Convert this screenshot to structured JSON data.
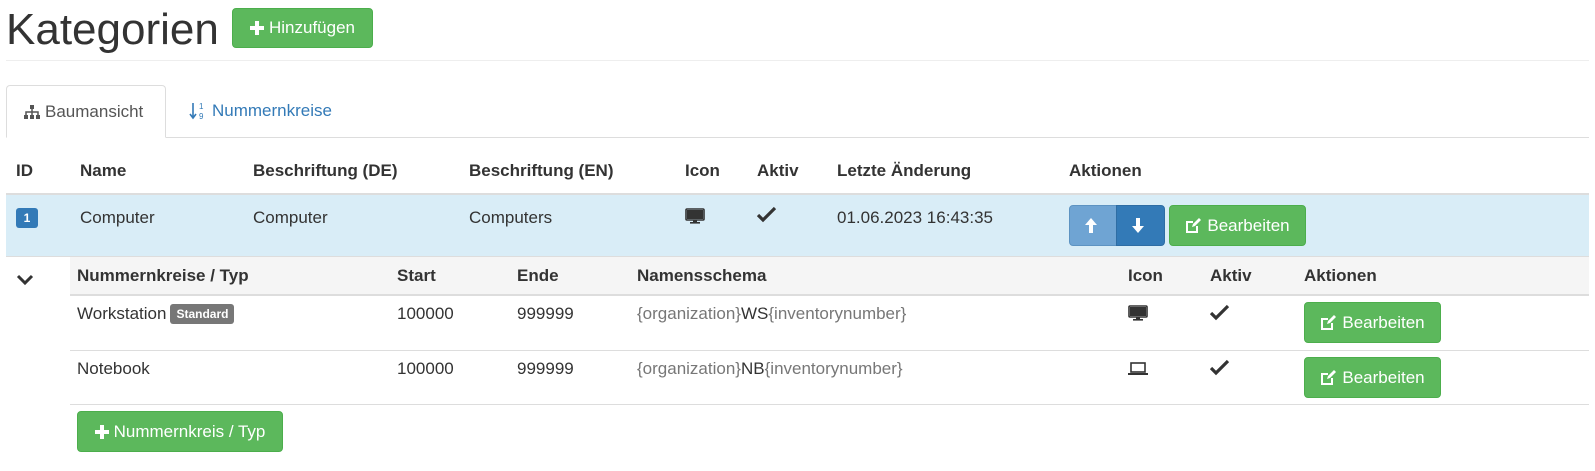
{
  "header": {
    "title": "Kategorien",
    "add_label": "Hinzufügen"
  },
  "tabs": [
    {
      "label": "Baumansicht",
      "icon": "sitemap-icon",
      "active": true
    },
    {
      "label": "Nummernkreise",
      "icon": "sort-numeric-icon",
      "active": false
    }
  ],
  "table": {
    "columns": [
      "ID",
      "Name",
      "Beschriftung (DE)",
      "Beschriftung (EN)",
      "Icon",
      "Aktiv",
      "Letzte Änderung",
      "Aktionen"
    ],
    "row": {
      "id": "1",
      "name": "Computer",
      "label_de": "Computer",
      "label_en": "Computers",
      "icon": "desktop-icon",
      "active": true,
      "last_change": "01.06.2023 16:43:35",
      "edit_label": "Bearbeiten"
    }
  },
  "subtable": {
    "columns": [
      "Nummernkreise / Typ",
      "Start",
      "Ende",
      "Namensschema",
      "Icon",
      "Aktiv",
      "Aktionen"
    ],
    "rows": [
      {
        "type": "Workstation",
        "badge": "Standard",
        "start": "100000",
        "end": "999999",
        "schema_pre": "{organization}",
        "schema_mid": "WS",
        "schema_post": "{inventorynumber}",
        "icon": "desktop-icon",
        "active": true,
        "edit_label": "Bearbeiten"
      },
      {
        "type": "Notebook",
        "badge": "",
        "start": "100000",
        "end": "999999",
        "schema_pre": "{organization}",
        "schema_mid": "NB",
        "schema_post": "{inventorynumber}",
        "icon": "laptop-icon",
        "active": true,
        "edit_label": "Bearbeiten"
      }
    ],
    "add_label": "Nummernkreis / Typ"
  },
  "colors": {
    "success": "#5cb85c",
    "primary": "#337ab7",
    "row_highlight": "#d9edf7"
  }
}
